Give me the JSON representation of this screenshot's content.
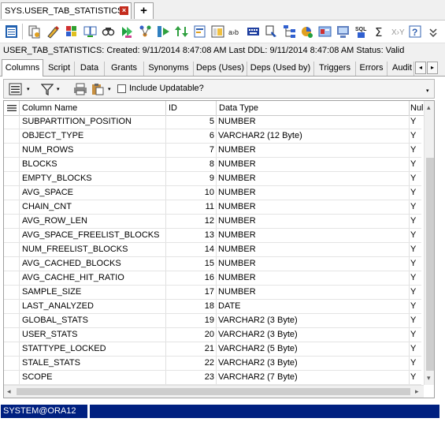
{
  "doc_tab": {
    "title": "SYS.USER_TAB_STATISTICS",
    "close_glyph": "×",
    "new_tab_glyph": "+"
  },
  "info": {
    "text": "USER_TAB_STATISTICS:   Created: 9/11/2014 8:47:08 AM    Last DDL: 9/11/2014 8:47:08 AM    Status:  Valid"
  },
  "tabs": [
    "Columns",
    "Script",
    "Data",
    "Grants",
    "Synonyms",
    "Deps (Uses)",
    "Deps (Used by)",
    "Triggers",
    "Errors",
    "Audit"
  ],
  "tab_scroll": {
    "left": "◂",
    "right": "▸"
  },
  "grid_toolbar": {
    "include_updatable": "Include Updatable?",
    "dropdown_glyph": "▾"
  },
  "grid": {
    "headers": [
      "Column Name",
      "ID",
      "Data Type",
      "Null"
    ],
    "rows": [
      {
        "name": "SUBPARTITION_POSITION",
        "id": "5",
        "type": "NUMBER",
        "null": "Y"
      },
      {
        "name": "OBJECT_TYPE",
        "id": "6",
        "type": "VARCHAR2 (12 Byte)",
        "null": "Y"
      },
      {
        "name": "NUM_ROWS",
        "id": "7",
        "type": "NUMBER",
        "null": "Y"
      },
      {
        "name": "BLOCKS",
        "id": "8",
        "type": "NUMBER",
        "null": "Y"
      },
      {
        "name": "EMPTY_BLOCKS",
        "id": "9",
        "type": "NUMBER",
        "null": "Y"
      },
      {
        "name": "AVG_SPACE",
        "id": "10",
        "type": "NUMBER",
        "null": "Y"
      },
      {
        "name": "CHAIN_CNT",
        "id": "11",
        "type": "NUMBER",
        "null": "Y"
      },
      {
        "name": "AVG_ROW_LEN",
        "id": "12",
        "type": "NUMBER",
        "null": "Y"
      },
      {
        "name": "AVG_SPACE_FREELIST_BLOCKS",
        "id": "13",
        "type": "NUMBER",
        "null": "Y"
      },
      {
        "name": "NUM_FREELIST_BLOCKS",
        "id": "14",
        "type": "NUMBER",
        "null": "Y"
      },
      {
        "name": "AVG_CACHED_BLOCKS",
        "id": "15",
        "type": "NUMBER",
        "null": "Y"
      },
      {
        "name": "AVG_CACHE_HIT_RATIO",
        "id": "16",
        "type": "NUMBER",
        "null": "Y"
      },
      {
        "name": "SAMPLE_SIZE",
        "id": "17",
        "type": "NUMBER",
        "null": "Y"
      },
      {
        "name": "LAST_ANALYZED",
        "id": "18",
        "type": "DATE",
        "null": "Y"
      },
      {
        "name": "GLOBAL_STATS",
        "id": "19",
        "type": "VARCHAR2 (3 Byte)",
        "null": "Y"
      },
      {
        "name": "USER_STATS",
        "id": "20",
        "type": "VARCHAR2 (3 Byte)",
        "null": "Y"
      },
      {
        "name": "STATTYPE_LOCKED",
        "id": "21",
        "type": "VARCHAR2 (5 Byte)",
        "null": "Y"
      },
      {
        "name": "STALE_STATS",
        "id": "22",
        "type": "VARCHAR2 (3 Byte)",
        "null": "Y"
      },
      {
        "name": "SCOPE",
        "id": "23",
        "type": "VARCHAR2 (7 Byte)",
        "null": "Y"
      }
    ]
  },
  "scroll_glyphs": {
    "up": "▴",
    "down": "▾",
    "left": "◂",
    "right": "▸"
  },
  "status": {
    "connection": "SYSTEM@ORA12"
  },
  "colors": {
    "status_bar": "#002080",
    "close_button": "#c42b1c"
  }
}
